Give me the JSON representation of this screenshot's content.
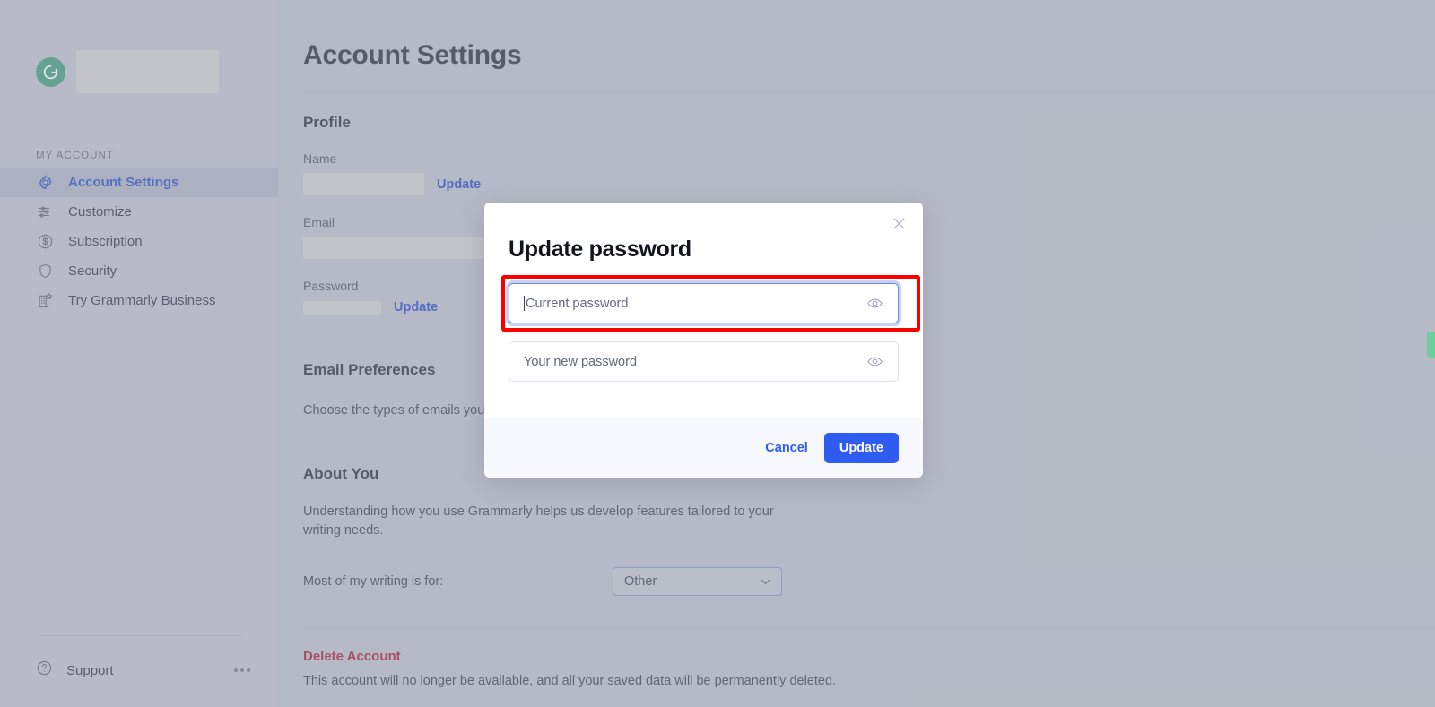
{
  "sidebar": {
    "brand": {
      "logo_icon": "grammarly-g-logo",
      "name_redacted": true
    },
    "section_label": "MY ACCOUNT",
    "items": [
      {
        "label": "Account Settings",
        "icon": "gear-icon",
        "active": true
      },
      {
        "label": "Customize",
        "icon": "sliders-icon",
        "active": false
      },
      {
        "label": "Subscription",
        "icon": "dollar-circle-icon",
        "active": false
      },
      {
        "label": "Security",
        "icon": "shield-icon",
        "active": false
      },
      {
        "label": "Try Grammarly Business",
        "icon": "building-star-icon",
        "active": false
      }
    ],
    "support": {
      "label": "Support",
      "icon": "question-circle-icon",
      "more_icon": "ellipsis-icon"
    }
  },
  "main": {
    "page_title": "Account Settings",
    "profile": {
      "heading": "Profile",
      "name_label": "Name",
      "name_update": "Update",
      "email_label": "Email",
      "password_label": "Password",
      "password_update": "Update"
    },
    "email_preferences": {
      "heading": "Email Preferences",
      "description": "Choose the types of emails you"
    },
    "about_you": {
      "heading": "About You",
      "description": "Understanding how you use Grammarly helps us develop features tailored to your writing needs.",
      "select_label": "Most of my writing is for:",
      "select_value": "Other",
      "select_icon": "chevron-down-icon"
    },
    "delete_account": {
      "title": "Delete Account",
      "description": "This account will no longer be available, and all your saved data will be permanently deleted."
    }
  },
  "modal": {
    "title": "Update password",
    "close_icon": "close-icon",
    "current_password": {
      "placeholder": "Current password",
      "value": "",
      "focused": true,
      "reveal_icon": "eye-icon",
      "highlighted": true
    },
    "new_password": {
      "placeholder": "Your new password",
      "value": "",
      "focused": false,
      "reveal_icon": "eye-icon"
    },
    "cancel_label": "Cancel",
    "update_label": "Update"
  },
  "edge_tab": {
    "name": "feedback-tab"
  },
  "colors": {
    "accent_blue": "#2e5bf0",
    "link_blue": "#3558cc",
    "danger_red": "#ad2f49",
    "annotation_red": "#fc0000",
    "brand_green": "#4fa488",
    "edge_tab_green": "#6cce9c",
    "overlay_bg": "#c2c6d0"
  }
}
